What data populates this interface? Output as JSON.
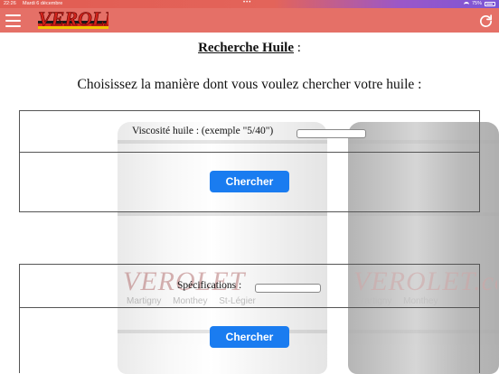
{
  "status_bar": {
    "time": "22:26",
    "date": "Mardi 6 décembre",
    "dots": "•••",
    "battery": "75%"
  },
  "header": {
    "logo_text": "VEROLET",
    "menu_icon": "hamburger-menu-icon",
    "refresh_icon": "refresh-icon",
    "bar_color": "#e57067"
  },
  "background": {
    "barrel_left_label": "VEROLET",
    "barrel_left_towns": "Martigny Monthey St-Légier",
    "barrel_right_label": "VEROLET.co",
    "barrel_right_towns": "Martigny Monthey"
  },
  "page": {
    "title": "Recherche Huile",
    "title_suffix": " :",
    "subtitle": "Choisissez la manière dont vous voulez chercher votre huile :"
  },
  "search_viscosity": {
    "label": "Viscosité huile : (exemple \"5/40\")",
    "value": "",
    "placeholder": "",
    "button_label": "Chercher"
  },
  "search_specs": {
    "label": "Spécifications :",
    "value": "",
    "placeholder": "",
    "button_label": "Chercher"
  },
  "colors": {
    "accent_button": "#1a7cf0",
    "header": "#e57067"
  }
}
